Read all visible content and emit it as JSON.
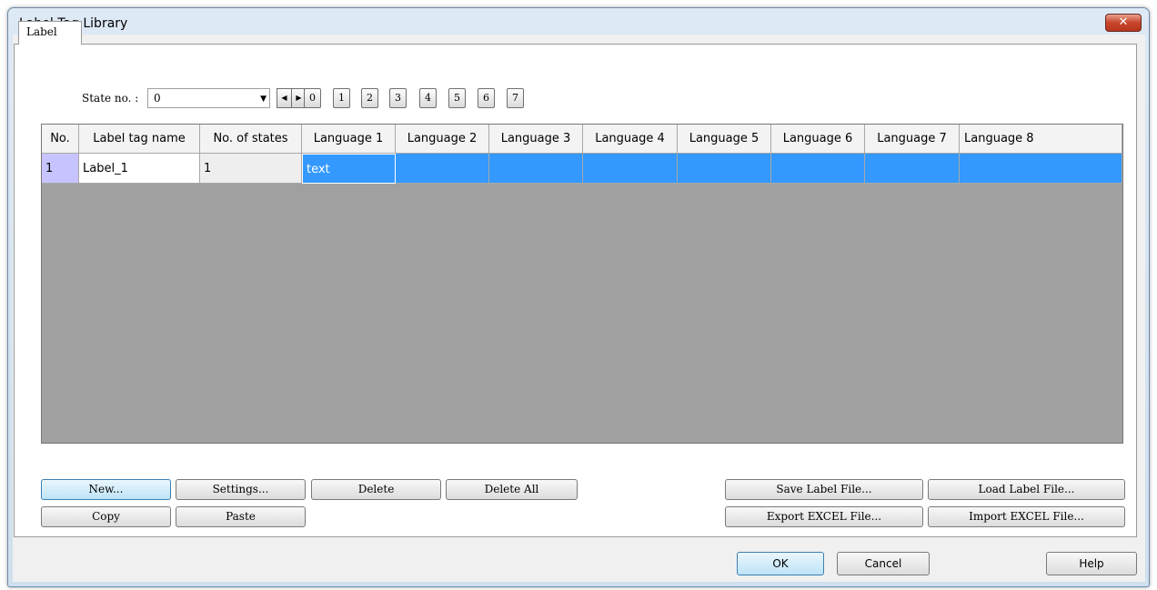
{
  "window": {
    "title": "Label Tag Library",
    "close_glyph": "✕"
  },
  "tabs": [
    {
      "label": "Label"
    }
  ],
  "state": {
    "label": "State no. :",
    "value": "0",
    "dropdown_glyph": "▼",
    "prev_glyph": "◀",
    "next_glyph": "▶",
    "buttons": [
      "0",
      "1",
      "2",
      "3",
      "4",
      "5",
      "6",
      "7"
    ]
  },
  "table": {
    "columns": [
      "No.",
      "Label tag name",
      "No. of states",
      "Language 1",
      "Language 2",
      "Language 3",
      "Language 4",
      "Language 5",
      "Language 6",
      "Language 7",
      "Language 8"
    ],
    "rows": [
      {
        "no": "1",
        "name": "Label_1",
        "states": "1",
        "languages": [
          "text",
          "",
          "",
          "",
          "",
          "",
          "",
          ""
        ]
      }
    ]
  },
  "buttons": {
    "new": "New...",
    "settings": "Settings...",
    "delete": "Delete",
    "delete_all": "Delete All",
    "copy": "Copy",
    "paste": "Paste",
    "save_label_file": "Save Label File...",
    "load_label_file": "Load Label File...",
    "export_excel": "Export EXCEL File...",
    "import_excel": "Import EXCEL File..."
  },
  "dialog_buttons": {
    "ok": "OK",
    "cancel": "Cancel",
    "help": "Help"
  },
  "colors": {
    "selection": "#3399ff",
    "grid_background": "#a0a0a0",
    "row_number_cell": "#c7c3ff"
  }
}
